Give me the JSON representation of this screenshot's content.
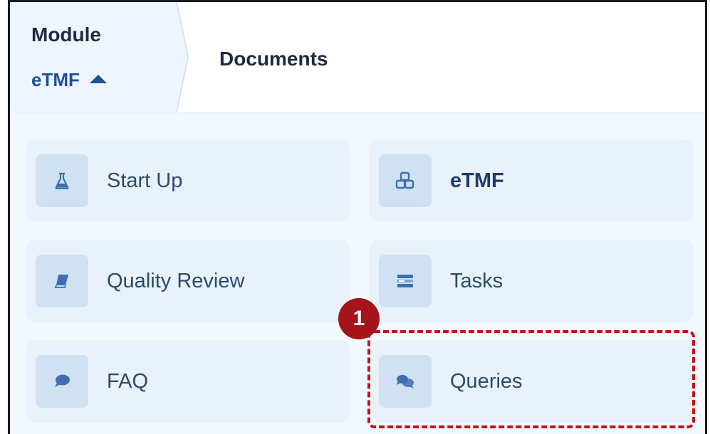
{
  "header": {
    "module_label": "Module",
    "module_value": "eTMF",
    "breadcrumb_current": "Documents"
  },
  "tiles": [
    {
      "label": "Start Up",
      "icon": "flask-icon"
    },
    {
      "label": "eTMF",
      "icon": "cubes-icon"
    },
    {
      "label": "Quality Review",
      "icon": "book-icon"
    },
    {
      "label": "Tasks",
      "icon": "tasks-list-icon"
    },
    {
      "label": "FAQ",
      "icon": "comment-icon"
    },
    {
      "label": "Queries",
      "icon": "comments-icon"
    }
  ],
  "annotation": {
    "step": "1",
    "color": "#c0141c"
  },
  "colors": {
    "icon": "#3f6fb0",
    "tile_bg": "#e9f2fb",
    "icon_box_bg": "#cfe1f3",
    "accent_text": "#1e4f9c"
  }
}
